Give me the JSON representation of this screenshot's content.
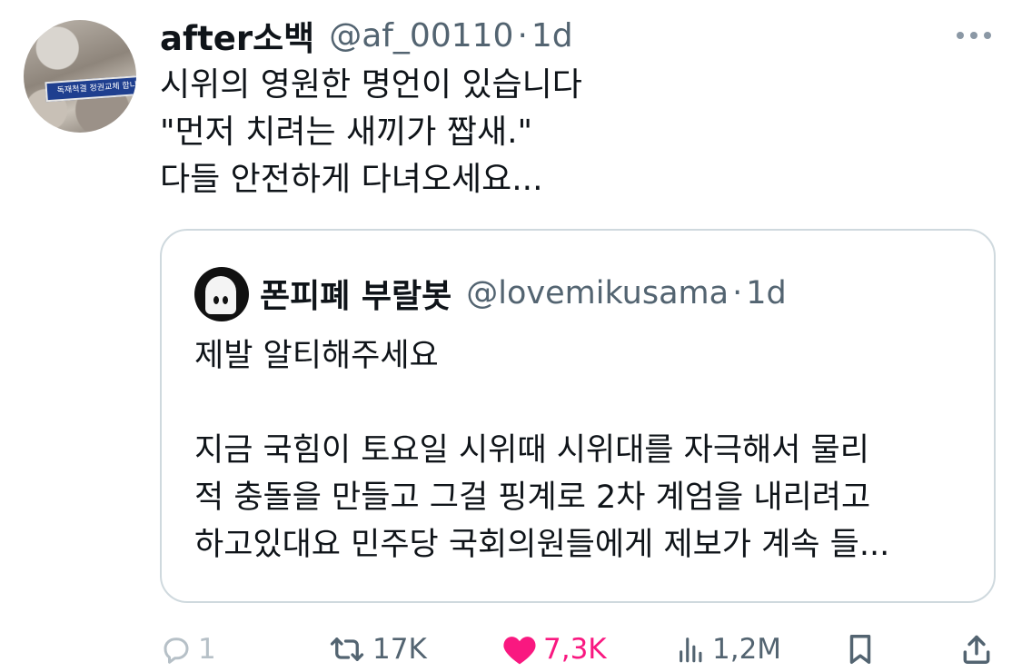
{
  "tweet": {
    "display_name": "after소백",
    "handle": "@af_00110",
    "separator": "·",
    "time": "1d",
    "avatar_banner_text": "독재척결 정권교체 합니다",
    "text_lines": [
      "시위의 영원한 명언이 있습니다",
      "\"먼저 치려는 새끼가 짭새.\"",
      "다들 안전하게 다녀오세요..."
    ]
  },
  "quoted": {
    "display_name": "폰피폐 부랄봇",
    "handle": "@lovemikusama",
    "separator": "·",
    "time": "1d",
    "text_lines": [
      "제발 알티해주세요",
      "",
      "지금 국힘이 토요일 시위때 시위대를 자극해서 물리",
      "적 충돌을 만들고 그걸 핑계로 2차 계엄을 내리려고",
      "하고있대요 민주당 국회의원들에게 제보가 계속 들..."
    ]
  },
  "actions": {
    "reply_count": "1",
    "retweet_count": "17K",
    "like_count": "7,3K",
    "views_count": "1,2M"
  },
  "icons": {
    "reply": "reply-icon",
    "retweet": "retweet-icon",
    "like": "heart-icon",
    "views": "views-icon",
    "bookmark": "bookmark-icon",
    "share": "share-icon",
    "more": "more-icon"
  },
  "colors": {
    "text": "#0f1419",
    "secondary": "#536471",
    "like": "#f91880",
    "border": "#cfd9de"
  }
}
